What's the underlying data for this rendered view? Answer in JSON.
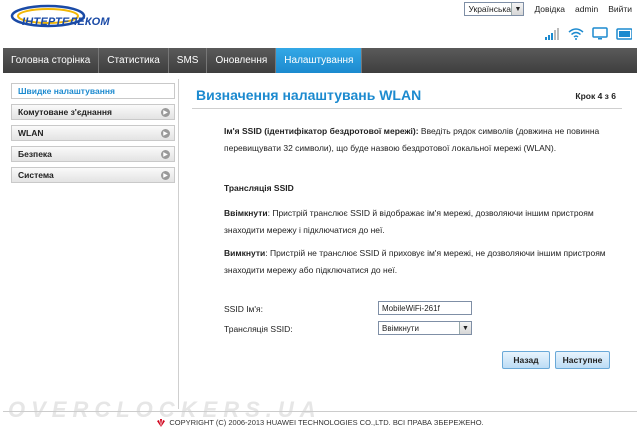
{
  "header": {
    "logo_text": "ІНТЕРТЕЛЕКОМ",
    "language": "Українська",
    "help_link": "Довідка",
    "user_link": "admin",
    "logout_link": "Вийти"
  },
  "nav": {
    "items": [
      {
        "label": "Головна сторінка",
        "active": false
      },
      {
        "label": "Статистика",
        "active": false
      },
      {
        "label": "SMS",
        "active": false
      },
      {
        "label": "Оновлення",
        "active": false
      },
      {
        "label": "Налаштування",
        "active": true
      }
    ]
  },
  "sidebar": {
    "items": [
      {
        "label": "Швидке налаштування",
        "active": true
      },
      {
        "label": "Комутоване з'єднання",
        "active": false
      },
      {
        "label": "WLAN",
        "active": false
      },
      {
        "label": "Безпека",
        "active": false
      },
      {
        "label": "Система",
        "active": false
      }
    ]
  },
  "main": {
    "title": "Визначення налаштувань WLAN",
    "step": "Крок 4 з 6",
    "ssid_desc_bold": "Ім'я SSID (ідентифікатор бездротової мережі):",
    "ssid_desc_text": " Введіть рядок символів (довжина не повинна перевищувати 32 символи), що буде назвою бездротової локальної мережі (WLAN).",
    "broadcast_heading": "Трансляція SSID",
    "enable_bold": "Ввімкнути",
    "enable_text": ": Пристрій транслює SSID й відображає ім'я мережі, дозволяючи іншим пристроям знаходити мережу і підключатися до неї.",
    "disable_bold": "Вимкнути",
    "disable_text": ": Пристрій не транслює SSID й приховує ім'я мережі, не дозволяючи іншим пристроям знаходити мережу або підключатися до неї.",
    "ssid_label": "SSID Ім'я:",
    "ssid_value": "MobileWiFi-261f",
    "broadcast_label": "Трансляція SSID:",
    "broadcast_value": "Ввімкнути",
    "back_button": "Назад",
    "next_button": "Наступне"
  },
  "footer": {
    "watermark": "OVERCLOCKERS.UA",
    "copyright": "COPYRIGHT (C) 2006-2013 HUAWEI TECHNOLOGIES CO.,LTD. ВСІ ПРАВА ЗБЕРЕЖЕНО."
  },
  "colors": {
    "accent": "#1c8acf",
    "nav_bg": "#4a4a4a",
    "huawei_red": "#d0021b"
  }
}
